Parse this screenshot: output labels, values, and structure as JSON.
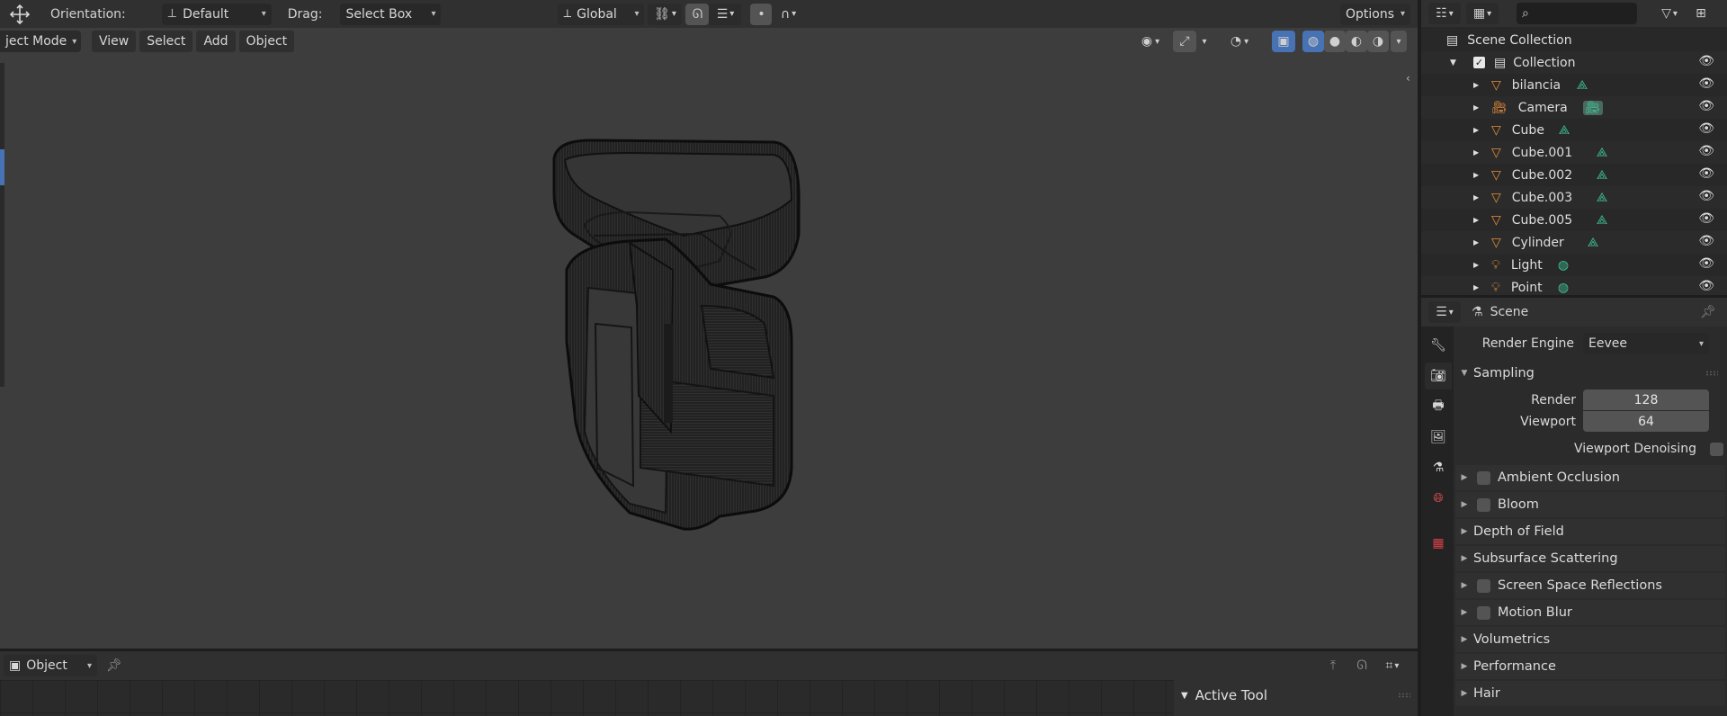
{
  "header": {
    "orientation_label": "Orientation:",
    "orientation_value": "Default",
    "drag_label": "Drag:",
    "drag_value": "Select Box",
    "transform_space": "Global",
    "options_label": "Options"
  },
  "menu": {
    "mode": "ject Mode",
    "items": [
      "View",
      "Select",
      "Add",
      "Object"
    ]
  },
  "bottom": {
    "mode": "Object",
    "active_tool_title": "Active Tool"
  },
  "outliner": {
    "root": "Scene Collection",
    "collection": "Collection",
    "items": [
      {
        "name": "bilancia",
        "type": "mesh"
      },
      {
        "name": "Camera",
        "type": "camera"
      },
      {
        "name": "Cube",
        "type": "mesh"
      },
      {
        "name": "Cube.001",
        "type": "mesh"
      },
      {
        "name": "Cube.002",
        "type": "mesh"
      },
      {
        "name": "Cube.003",
        "type": "mesh"
      },
      {
        "name": "Cube.005",
        "type": "mesh"
      },
      {
        "name": "Cylinder",
        "type": "mesh"
      },
      {
        "name": "Light",
        "type": "light"
      },
      {
        "name": "Point",
        "type": "light"
      }
    ]
  },
  "properties": {
    "context": "Scene",
    "render_engine_label": "Render Engine",
    "render_engine_value": "Eevee",
    "sampling": {
      "title": "Sampling",
      "render_label": "Render",
      "render_value": "128",
      "viewport_label": "Viewport",
      "viewport_value": "64",
      "denoise_label": "Viewport Denoising"
    },
    "panels": [
      {
        "label": "Ambient Occlusion",
        "checkbox": true
      },
      {
        "label": "Bloom",
        "checkbox": true
      },
      {
        "label": "Depth of Field",
        "checkbox": false
      },
      {
        "label": "Subsurface Scattering",
        "checkbox": false
      },
      {
        "label": "Screen Space Reflections",
        "checkbox": true
      },
      {
        "label": "Motion Blur",
        "checkbox": true
      },
      {
        "label": "Volumetrics",
        "checkbox": false
      },
      {
        "label": "Performance",
        "checkbox": false
      },
      {
        "label": "Hair",
        "checkbox": false
      }
    ]
  },
  "colors": {
    "accent_blue": "#4772b3",
    "mesh_orange": "#e58c3a",
    "data_green": "#3fc59a"
  }
}
